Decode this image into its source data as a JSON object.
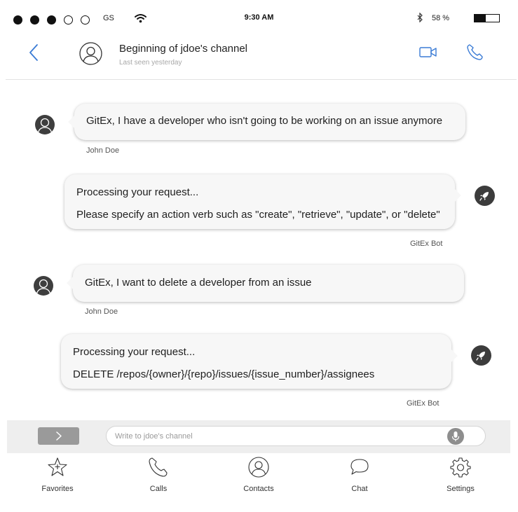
{
  "status_bar": {
    "signal_dots": [
      "filled",
      "filled",
      "filled",
      "empty",
      "empty"
    ],
    "carrier": "GS",
    "time": "9:30 AM",
    "battery_text": "58 %",
    "battery_level": 0.58
  },
  "header": {
    "back_icon": "chevron-left-icon",
    "title": "Beginning of jdoe's channel",
    "subtitle": "Last seen yesterday",
    "video_icon": "video-camera-icon",
    "call_icon": "phone-icon"
  },
  "messages": [
    {
      "from": "user",
      "sender": "John Doe",
      "lines": [
        "GitEx, I have a developer who isn't going to be working on an issue anymore"
      ]
    },
    {
      "from": "bot",
      "sender": "GitEx Bot",
      "lines": [
        "Processing your request...",
        "Please specify an action verb such as \"create\", \"retrieve\", \"update\", or \"delete\""
      ]
    },
    {
      "from": "user",
      "sender": "John Doe",
      "lines": [
        "GitEx, I want to delete a developer from an issue"
      ]
    },
    {
      "from": "bot",
      "sender": "GitEx Bot",
      "lines": [
        "Processing your request...",
        "DELETE /repos/{owner}/{repo}/issues/{issue_number}/assignees"
      ]
    }
  ],
  "composer": {
    "send_icon": "chevron-right-icon",
    "placeholder": "Write to jdoe's channel",
    "value": "",
    "mic_icon": "microphone-icon"
  },
  "tabs": [
    {
      "label": "Favorites",
      "icon": "star-icon"
    },
    {
      "label": "Calls",
      "icon": "phone-icon"
    },
    {
      "label": "Contacts",
      "icon": "contact-icon"
    },
    {
      "label": "Chat",
      "icon": "chat-bubble-icon"
    },
    {
      "label": "Settings",
      "icon": "gear-icon"
    }
  ],
  "colors": {
    "accent": "#3a7bd5",
    "bubble": "#f7f7f7",
    "avatar": "#3e3e3e"
  }
}
